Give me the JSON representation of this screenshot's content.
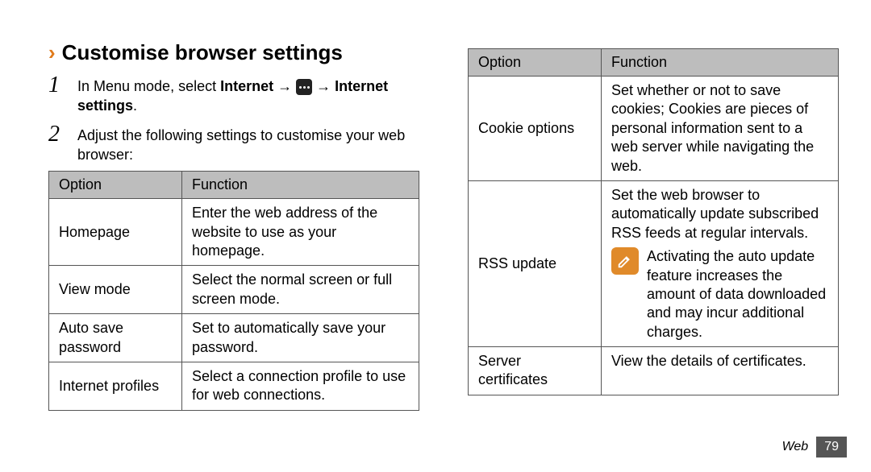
{
  "heading": "Customise browser settings",
  "step1_prefix": "In Menu mode, select ",
  "step1_bold1": "Internet",
  "step1_arrow": " → ",
  "step1_arrow2": " → ",
  "step1_bold2": "Internet settings",
  "step1_period": ".",
  "step2": "Adjust the following settings to customise your web browser:",
  "th_option": "Option",
  "th_function": "Function",
  "left_rows": [
    {
      "opt": "Homepage",
      "fn": "Enter the web address of the website to use as your homepage."
    },
    {
      "opt": "View mode",
      "fn": "Select the normal screen or full screen mode."
    },
    {
      "opt": "Auto save password",
      "fn": "Set to automatically save your password."
    },
    {
      "opt": "Internet profiles",
      "fn": "Select a connection profile to use for web connections."
    }
  ],
  "right_rows": {
    "cookie_opt": "Cookie options",
    "cookie_fn": "Set whether or not to save cookies; Cookies are pieces of personal information sent to a web server while navigating the web.",
    "rss_opt": "RSS update",
    "rss_fn_top": "Set the web browser to automatically update subscribed RSS feeds at regular intervals.",
    "rss_note": "Activating the auto update feature increases the amount of data downloaded and may incur additional charges.",
    "cert_opt": "Server certificates",
    "cert_fn": "View the details of certificates."
  },
  "footer_section": "Web",
  "footer_page": "79"
}
